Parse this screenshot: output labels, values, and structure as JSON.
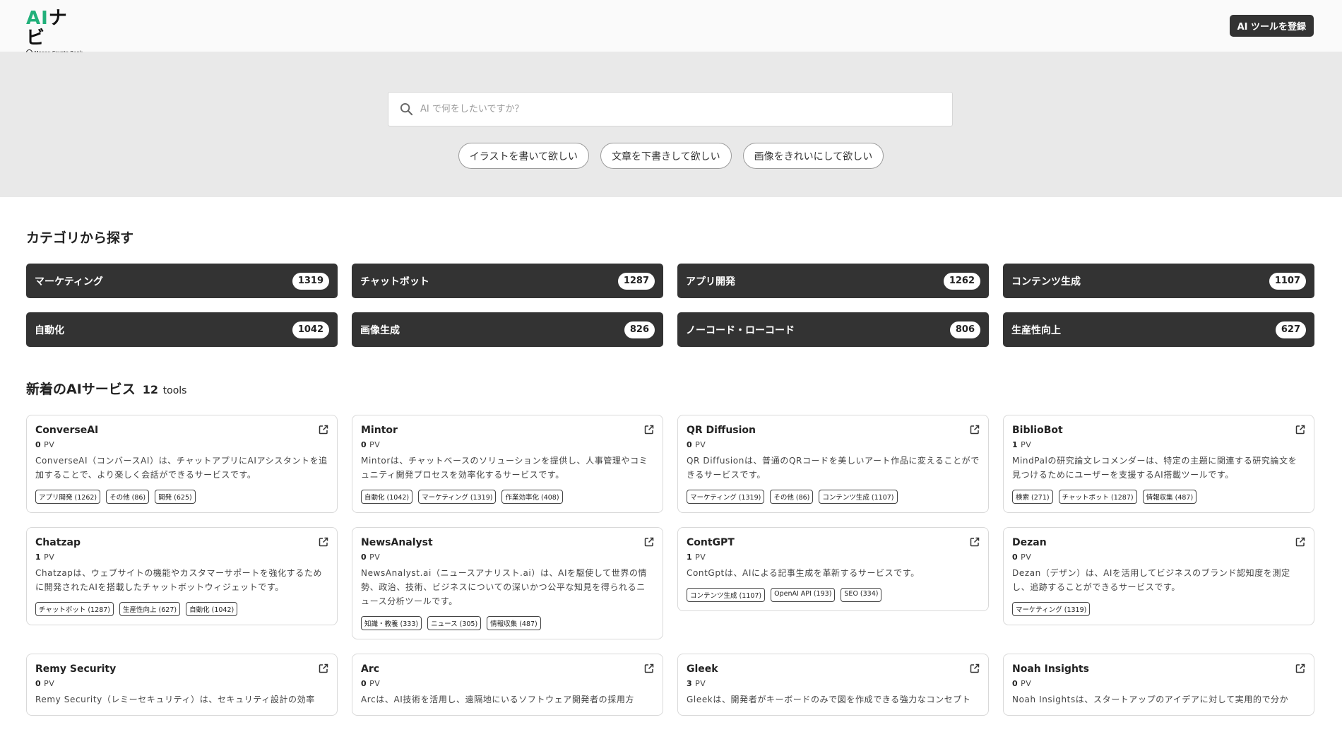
{
  "header": {
    "logo_ai": "AI",
    "logo_navi": "ナビ",
    "logo_sub": "Monex Crypto Bank",
    "register_label": "AI ツールを登録"
  },
  "search": {
    "placeholder": "AI で何をしたいですか？"
  },
  "suggestions": [
    "イラストを書いて欲しい",
    "文章を下書きして欲しい",
    "画像をきれいにして欲しい"
  ],
  "category_section": {
    "title": "カテゴリから探す",
    "items": [
      {
        "label": "マーケティング",
        "count": "1319"
      },
      {
        "label": "チャットボット",
        "count": "1287"
      },
      {
        "label": "アプリ開発",
        "count": "1262"
      },
      {
        "label": "コンテンツ生成",
        "count": "1107"
      },
      {
        "label": "自動化",
        "count": "1042"
      },
      {
        "label": "画像生成",
        "count": "826"
      },
      {
        "label": "ノーコード・ローコード",
        "count": "806"
      },
      {
        "label": "生産性向上",
        "count": "627"
      }
    ]
  },
  "new_section": {
    "title": "新着のAIサービス",
    "count": "12",
    "unit": "tools"
  },
  "tools": [
    {
      "name": "ConverseAI",
      "pv": "0",
      "desc": "ConverseAI（コンバースAI）は、チャットアプリにAIアシスタントを追加することで、より楽しく会話ができるサービスです。",
      "tags": [
        "アプリ開発 (1262)",
        "その他 (86)",
        "開発 (625)"
      ]
    },
    {
      "name": "Mintor",
      "pv": "0",
      "desc": "Mintorは、チャットベースのソリューションを提供し、人事管理やコミュニティ開発プロセスを効率化するサービスです。",
      "tags": [
        "自動化 (1042)",
        "マーケティング (1319)",
        "作業効率化 (408)"
      ]
    },
    {
      "name": "QR Diffusion",
      "pv": "0",
      "desc": "QR Diffusionは、普通のQRコードを美しいアート作品に変えることができるサービスです。",
      "tags": [
        "マーケティング (1319)",
        "その他 (86)",
        "コンテンツ生成 (1107)"
      ]
    },
    {
      "name": "BiblioBot",
      "pv": "1",
      "desc": "MindPalの研究論文レコメンダーは、特定の主題に関連する研究論文を見つけるためにユーザーを支援するAI搭載ツールです。",
      "tags": [
        "検索 (271)",
        "チャットボット (1287)",
        "情報収集 (487)"
      ]
    },
    {
      "name": "Chatzap",
      "pv": "1",
      "desc": "Chatzapは、ウェブサイトの機能やカスタマーサポートを強化するために開発されたAIを搭載したチャットボットウィジェットです。",
      "tags": [
        "チャットボット (1287)",
        "生産性向上 (627)",
        "自動化 (1042)"
      ]
    },
    {
      "name": "NewsAnalyst",
      "pv": "0",
      "desc": "NewsAnalyst.ai（ニュースアナリスト.ai）は、AIを駆使して世界の情勢、政治、技術、ビジネスについての深いかつ公平な知見を得られるニュース分析ツールです。",
      "tags": [
        "知識・教養 (333)",
        "ニュース (305)",
        "情報収集 (487)"
      ]
    },
    {
      "name": "ContGPT",
      "pv": "1",
      "desc": "ContGptは、AIによる記事生成を革新するサービスです。",
      "tags": [
        "コンテンツ生成 (1107)",
        "OpenAI API (193)",
        "SEO (334)"
      ]
    },
    {
      "name": "Dezan",
      "pv": "0",
      "desc": "Dezan（デザン）は、AIを活用してビジネスのブランド認知度を測定し、追跡することができるサービスです。",
      "tags": [
        "マーケティング (1319)"
      ]
    },
    {
      "name": "Remy Security",
      "pv": "0",
      "desc": "Remy Security（レミーセキュリティ）は、セキュリティ設計の効率",
      "tags": []
    },
    {
      "name": "Arc",
      "pv": "0",
      "desc": "Arcは、AI技術を活用し、遠隔地にいるソフトウェア開発者の採用方",
      "tags": []
    },
    {
      "name": "Gleek",
      "pv": "3",
      "desc": "Gleekは、開発者がキーボードのみで図を作成できる強力なコンセプト",
      "tags": []
    },
    {
      "name": "Noah Insights",
      "pv": "0",
      "desc": "Noah Insightsは、スタートアップのアイデアに対して実用的で分か",
      "tags": []
    }
  ],
  "pv_unit": "PV",
  "colors": {
    "brand_green": "#21b07a",
    "dark": "#333333",
    "hero_bg": "#e9e9e9"
  }
}
